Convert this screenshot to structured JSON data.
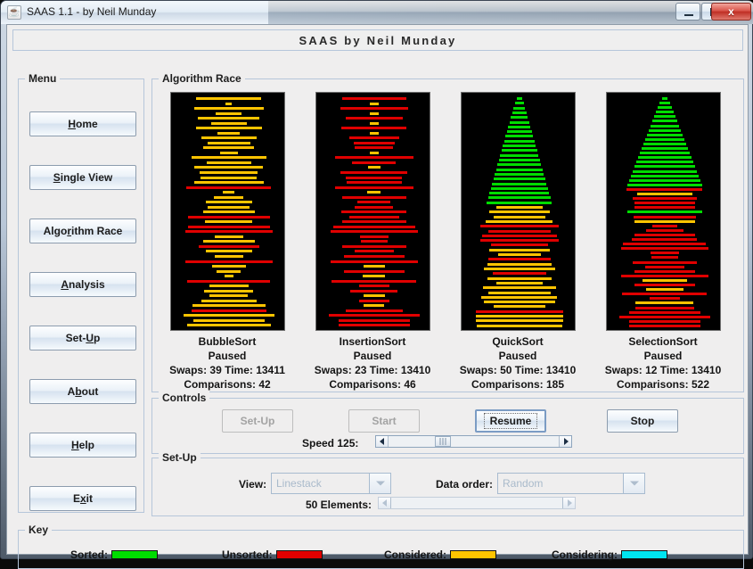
{
  "window": {
    "title": "SAAS 1.1 - by Neil Munday",
    "app_icon": "java-coffee-cup-icon",
    "minimize_label": "Minimize",
    "maximize_label": "Maximize",
    "close_label": "x"
  },
  "banner": {
    "text": "SAAS by Neil Munday"
  },
  "menu": {
    "title": "Menu",
    "items": [
      {
        "label": "Home",
        "mnemonic": "H"
      },
      {
        "label": "Single View",
        "mnemonic": "S"
      },
      {
        "label": "Algorithm Race",
        "mnemonic": "r"
      },
      {
        "label": "Analysis",
        "mnemonic": "A"
      },
      {
        "label": "Set-Up",
        "mnemonic": "U"
      },
      {
        "label": "About",
        "mnemonic": "b"
      },
      {
        "label": "Help",
        "mnemonic": "H"
      },
      {
        "label": "Exit",
        "mnemonic": "x"
      }
    ]
  },
  "race": {
    "title": "Algorithm Race",
    "algorithms": [
      {
        "name": "BubbleSort",
        "status": "Paused",
        "swaps_line": "Swaps: 39  Time: 13411",
        "comparisons_line": "Comparisons: 42",
        "swaps": 39,
        "time": 13411,
        "comparisons": 42
      },
      {
        "name": "InsertionSort",
        "status": "Paused",
        "swaps_line": "Swaps: 23  Time: 13410",
        "comparisons_line": "Comparisons: 46",
        "swaps": 23,
        "time": 13410,
        "comparisons": 46
      },
      {
        "name": "QuickSort",
        "status": "Paused",
        "swaps_line": "Swaps: 50  Time: 13410",
        "comparisons_line": "Comparisons: 185",
        "swaps": 50,
        "time": 13410,
        "comparisons": 185
      },
      {
        "name": "SelectionSort",
        "status": "Paused",
        "swaps_line": "Swaps: 12  Time: 13410",
        "comparisons_line": "Comparisons: 522",
        "swaps": 12,
        "time": 13410,
        "comparisons": 522
      }
    ],
    "bar_state_colors": {
      "sorted": "#00dd00",
      "unsorted": "#e00000",
      "considered": "#ffc400",
      "considering": "#00e5f0"
    },
    "linestacks": [
      {
        "widths": [
          73,
          7,
          78,
          29,
          69,
          40,
          74,
          25,
          62,
          48,
          57,
          20,
          84,
          50,
          77,
          65,
          63,
          78,
          95,
          13,
          33,
          52,
          47,
          58,
          92,
          53,
          92,
          98,
          32,
          58,
          68,
          52,
          32,
          98,
          38,
          27,
          10,
          93,
          44,
          55,
          43,
          62,
          82,
          84,
          102,
          80,
          94
        ],
        "states": [
          "considered",
          "considered",
          "considered",
          "considered",
          "considered",
          "considered",
          "considered",
          "considered",
          "considered",
          "considered",
          "considered",
          "considered",
          "considered",
          "considered",
          "considered",
          "considered",
          "considered",
          "considered",
          "unsorted",
          "considered",
          "considered",
          "considered",
          "considered",
          "considered",
          "unsorted",
          "considered",
          "unsorted",
          "unsorted",
          "considered",
          "considered",
          "unsorted",
          "considered",
          "considered",
          "unsorted",
          "considered",
          "considered",
          "considered",
          "unsorted",
          "considered",
          "considered",
          "considered",
          "considered",
          "considered",
          "unsorted",
          "considered",
          "considered",
          "considered"
        ]
      },
      {
        "widths": [
          72,
          10,
          76,
          10,
          64,
          10,
          73,
          10,
          56,
          46,
          43,
          10,
          88,
          49,
          14,
          75,
          63,
          62,
          88,
          15,
          72,
          37,
          43,
          73,
          56,
          72,
          92,
          98,
          32,
          30,
          72,
          44,
          68,
          98,
          24,
          68,
          25,
          95,
          34,
          53,
          24,
          34,
          23,
          64,
          102,
          80,
          80
        ],
        "states": [
          "unsorted",
          "considered",
          "unsorted",
          "considered",
          "unsorted",
          "considered",
          "unsorted",
          "considered",
          "unsorted",
          "unsorted",
          "unsorted",
          "considered",
          "unsorted",
          "unsorted",
          "considered",
          "unsorted",
          "unsorted",
          "unsorted",
          "unsorted",
          "considered",
          "unsorted",
          "unsorted",
          "unsorted",
          "unsorted",
          "unsorted",
          "unsorted",
          "unsorted",
          "unsorted",
          "unsorted",
          "unsorted",
          "unsorted",
          "unsorted",
          "unsorted",
          "unsorted",
          "considered",
          "unsorted",
          "considered",
          "unsorted",
          "unsorted",
          "unsorted",
          "considered",
          "unsorted",
          "considered",
          "unsorted",
          "unsorted",
          "unsorted",
          "unsorted"
        ]
      },
      {
        "widths": [
          6,
          10,
          13,
          16,
          19,
          22,
          25,
          28,
          31,
          34,
          37,
          40,
          43,
          46,
          49,
          52,
          55,
          58,
          61,
          64,
          67,
          70,
          73,
          52,
          68,
          58,
          75,
          88,
          70,
          84,
          88,
          64,
          68,
          48,
          70,
          72,
          80,
          60,
          72,
          52,
          82,
          70,
          85,
          80,
          58,
          98,
          98,
          98,
          96
        ],
        "states": [
          "sorted",
          "sorted",
          "sorted",
          "sorted",
          "sorted",
          "sorted",
          "sorted",
          "sorted",
          "sorted",
          "sorted",
          "sorted",
          "sorted",
          "sorted",
          "sorted",
          "sorted",
          "sorted",
          "sorted",
          "sorted",
          "sorted",
          "sorted",
          "sorted",
          "sorted",
          "sorted",
          "considered",
          "considered",
          "considered",
          "considered",
          "unsorted",
          "unsorted",
          "unsorted",
          "unsorted",
          "unsorted",
          "considered",
          "considered",
          "unsorted",
          "considered",
          "considered",
          "unsorted",
          "considered",
          "considered",
          "considered",
          "considered",
          "considered",
          "considered",
          "considered",
          "unsorted",
          "considered",
          "considered",
          "considered"
        ]
      },
      {
        "widths": [
          6,
          12,
          16,
          20,
          24,
          28,
          32,
          36,
          40,
          44,
          48,
          52,
          56,
          60,
          64,
          68,
          72,
          76,
          80,
          84,
          85,
          62,
          72,
          68,
          68,
          84,
          70,
          68,
          28,
          42,
          68,
          73,
          93,
          98,
          32,
          30,
          72,
          44,
          68,
          98,
          50,
          68,
          42,
          95,
          34,
          65,
          66,
          80,
          102,
          80,
          80
        ],
        "states": [
          "sorted",
          "sorted",
          "sorted",
          "sorted",
          "sorted",
          "sorted",
          "sorted",
          "sorted",
          "sorted",
          "sorted",
          "sorted",
          "sorted",
          "sorted",
          "sorted",
          "sorted",
          "sorted",
          "sorted",
          "sorted",
          "sorted",
          "sorted",
          "unsorted",
          "considered",
          "unsorted",
          "unsorted",
          "unsorted",
          "sorted",
          "unsorted",
          "considered",
          "unsorted",
          "unsorted",
          "unsorted",
          "unsorted",
          "unsorted",
          "unsorted",
          "unsorted",
          "unsorted",
          "unsorted",
          "unsorted",
          "unsorted",
          "unsorted",
          "considered",
          "unsorted",
          "considered",
          "unsorted",
          "unsorted",
          "considered",
          "unsorted",
          "unsorted",
          "unsorted",
          "unsorted",
          "unsorted"
        ]
      }
    ]
  },
  "controls": {
    "title": "Controls",
    "setup_button": "Set-Up",
    "setup_enabled": false,
    "start_button": "Start",
    "start_enabled": false,
    "resume_button": "Resume",
    "resume_focused": true,
    "stop_button": "Stop",
    "speed_label": "Speed 125:",
    "speed_value": 125
  },
  "setup": {
    "title": "Set-Up",
    "view_label": "View:",
    "view_value": "Linestack",
    "view_enabled": false,
    "data_order_label": "Data order:",
    "data_order_value": "Random",
    "data_order_enabled": false,
    "elements_label": "50 Elements:",
    "elements_value": 50,
    "elements_enabled": false
  },
  "key": {
    "title": "Key",
    "items": [
      {
        "label": "Sorted:",
        "color": "#00dd00"
      },
      {
        "label": "Unsorted:",
        "color": "#e00000"
      },
      {
        "label": "Considered:",
        "color": "#ffc400"
      },
      {
        "label": "Considering:",
        "color": "#00e5f0"
      }
    ]
  }
}
